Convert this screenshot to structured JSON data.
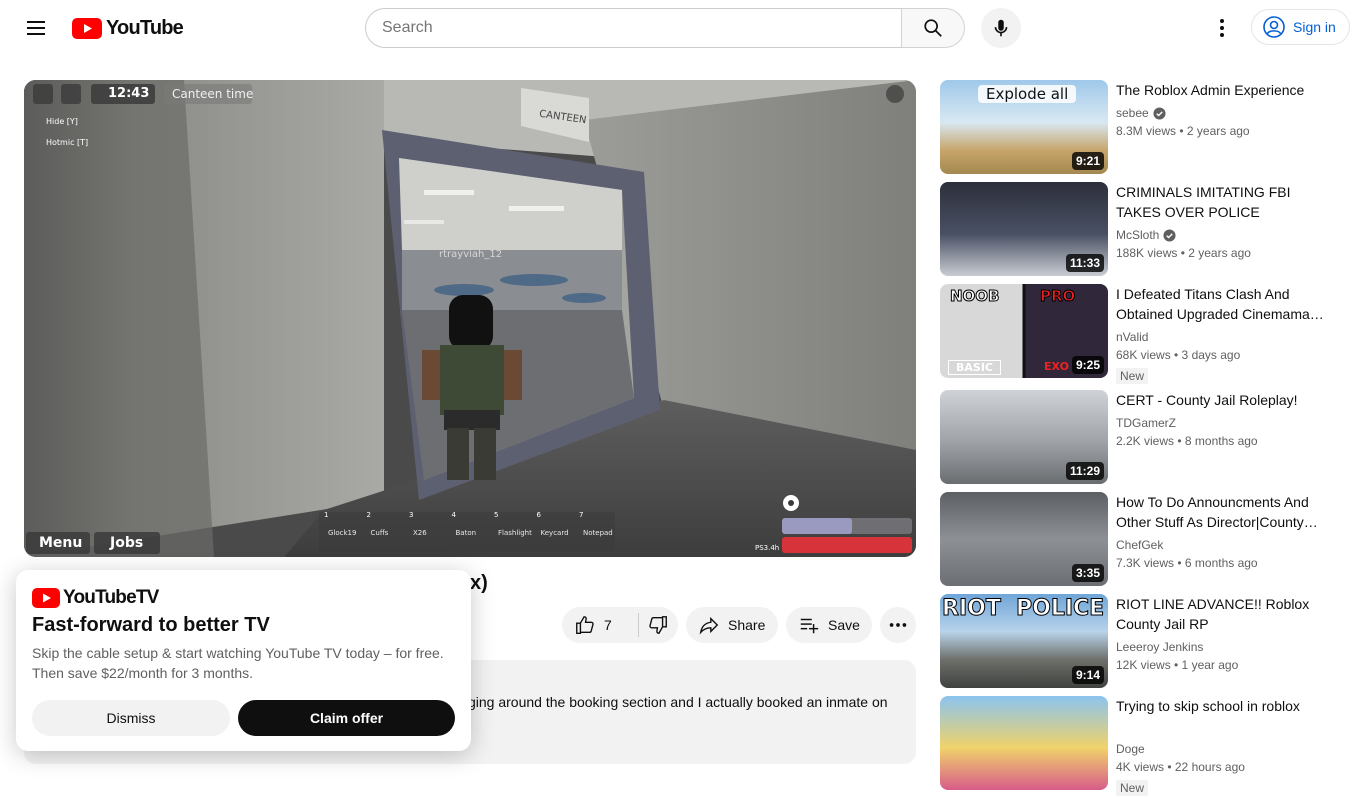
{
  "masthead": {
    "logo_text": "YouTube",
    "search_placeholder": "Search",
    "signin_label": "Sign in"
  },
  "player": {
    "hud_time": "12:43",
    "hud_period": "Canteen time",
    "hud_hide": "Hide [Y]",
    "hud_hotmic": "Hotmic [T]",
    "door_sign": "CANTEEN",
    "player_name": "rtrayviah_12",
    "btn_menu": "Menu",
    "btn_jobs": "Jobs",
    "ping": "PS3.4h",
    "hotbar": [
      {
        "num": "1",
        "label": "Glock19"
      },
      {
        "num": "2",
        "label": "Cuffs"
      },
      {
        "num": "3",
        "label": "X26"
      },
      {
        "num": "4",
        "label": "Baton"
      },
      {
        "num": "5",
        "label": "Flashlight"
      },
      {
        "num": "6",
        "label": "Keycard"
      },
      {
        "num": "7",
        "label": "Notepad"
      }
    ]
  },
  "video": {
    "title_fragment": "x)",
    "like_count": "7",
    "share_label": "Share",
    "save_label": "Save",
    "description_fragment": "ging around the booking section and I actually booked an inmate on"
  },
  "promo": {
    "logo_text": "YouTubeTV",
    "title": "Fast-forward to better TV",
    "body": "Skip the cable setup & start watching YouTube TV today – for free. Then save $22/month for 3 months.",
    "dismiss_label": "Dismiss",
    "claim_label": "Claim offer"
  },
  "related": [
    {
      "title": "The Roblox Admin Experience",
      "channel": "sebee",
      "verified": true,
      "meta": "8.3M views • 2 years ago",
      "duration": "9:21",
      "overlay": "Explode all",
      "badge": ""
    },
    {
      "title": "CRIMINALS IMITATING FBI TAKES OVER POLICE STATION…",
      "channel": "McSloth",
      "verified": true,
      "meta": "188K views • 2 years ago",
      "duration": "11:33",
      "overlay": "",
      "badge": ""
    },
    {
      "title": "I Defeated Titans Clash And Obtained Upgraded Cinemama…",
      "channel": "nValid",
      "verified": false,
      "meta": "68K views • 3 days ago",
      "duration": "9:25",
      "overlay_left": "NOOB",
      "overlay_right": "PRO",
      "overlay_bl": "BASIC",
      "overlay_br": "EXO",
      "badge": "New"
    },
    {
      "title": "CERT - County Jail Roleplay!",
      "channel": "TDGamerZ",
      "verified": false,
      "meta": "2.2K views • 8 months ago",
      "duration": "11:29",
      "overlay": "",
      "badge": ""
    },
    {
      "title": "How To Do Announcments And Other Stuff As Director|County…",
      "channel": "ChefGek",
      "verified": false,
      "meta": "7.3K views • 6 months ago",
      "duration": "3:35",
      "overlay": "",
      "badge": ""
    },
    {
      "title": "RIOT LINE ADVANCE!! Roblox County Jail RP",
      "channel": "Leeeroy Jenkins",
      "verified": false,
      "meta": "12K views • 1 year ago",
      "duration": "9:14",
      "overlay_left": "RIOT",
      "overlay_right": "POLICE",
      "badge": ""
    },
    {
      "title": "Trying to skip school in roblox",
      "channel": "Doge",
      "verified": false,
      "meta": "4K views • 22 hours ago",
      "duration": "",
      "overlay": "",
      "badge": "New"
    }
  ],
  "colors": {
    "brand_red": "#ff0000",
    "link_blue": "#065fd4",
    "pill_gray": "#f2f2f2"
  }
}
